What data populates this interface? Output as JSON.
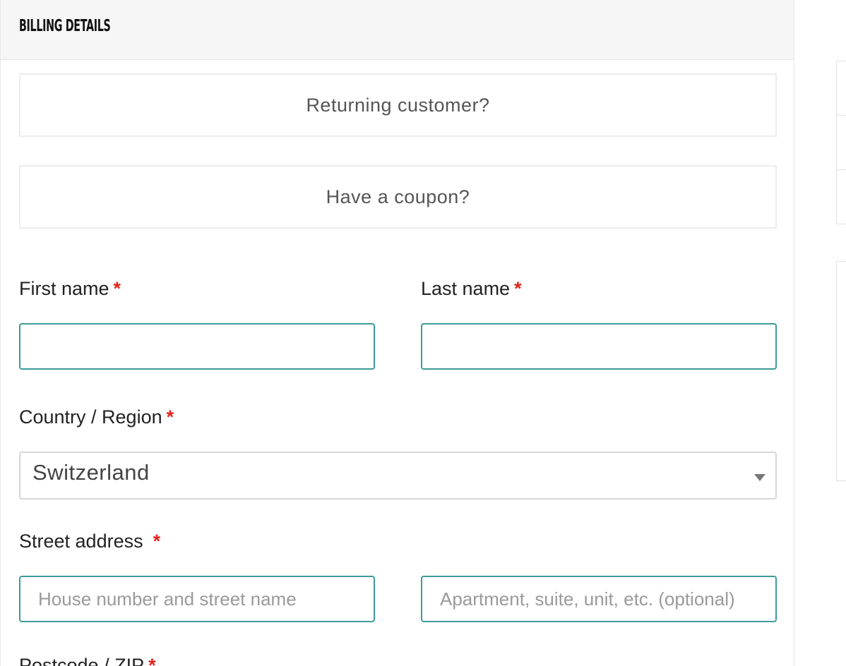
{
  "header": {
    "title": "Billing details"
  },
  "notices": {
    "returning_customer": "Returning customer?",
    "coupon": "Have a coupon?"
  },
  "required_marker": "*",
  "fields": {
    "first_name": {
      "label": "First name",
      "value": ""
    },
    "last_name": {
      "label": "Last name",
      "value": ""
    },
    "country": {
      "label": "Country / Region",
      "selected": "Switzerland"
    },
    "street": {
      "label": "Street address",
      "line1_placeholder": "House number and street name",
      "line2_placeholder": "Apartment, suite, unit, etc. (optional)"
    },
    "postcode": {
      "label": "Postcode / ZIP"
    }
  },
  "colors": {
    "accent": "#3b9b99",
    "required": "#e2231a",
    "header_bg": "#f6f6f6"
  }
}
